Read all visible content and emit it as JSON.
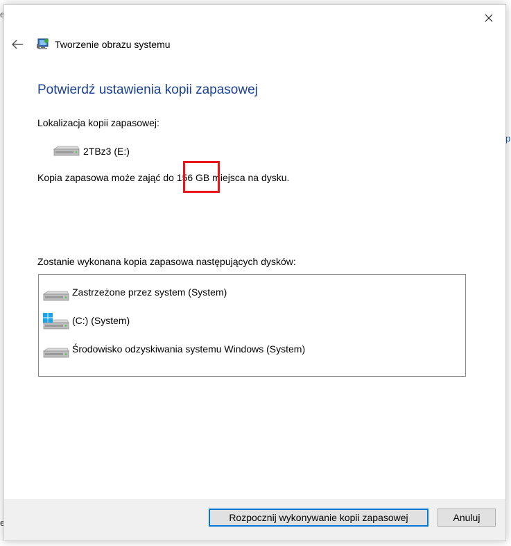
{
  "background_fragments": {
    "top_left": "e",
    "bottom_left": "e.",
    "right": "p"
  },
  "window": {
    "title": "Tworzenie obrazu systemu",
    "close_icon": "close-icon",
    "back_icon": "arrow-left-icon"
  },
  "content": {
    "heading": "Potwierdź ustawienia kopii zapasowej",
    "location_label": "Lokalizacja kopii zapasowej:",
    "target_drive": "2TBz3 (E:)",
    "size_prefix": "Kopia zapasowa może zająć do ",
    "size_value": "156 GB",
    "size_suffix": " miejsca na dysku.",
    "disks_label": "Zostanie wykonana kopia zapasowa następujących dysków:",
    "disks": [
      {
        "label": "Zastrzeżone przez system (System)",
        "icon": "drive-icon"
      },
      {
        "label": "(C:) (System)",
        "icon": "windows-drive-icon"
      },
      {
        "label": "Środowisko odzyskiwania systemu Windows (System)",
        "icon": "drive-icon"
      }
    ]
  },
  "buttons": {
    "start": "Rozpocznij wykonywanie kopii zapasowej",
    "cancel": "Anuluj"
  },
  "colors": {
    "heading": "#1a3f96",
    "highlight": "#e8151b",
    "primary_border": "#0078d7"
  }
}
